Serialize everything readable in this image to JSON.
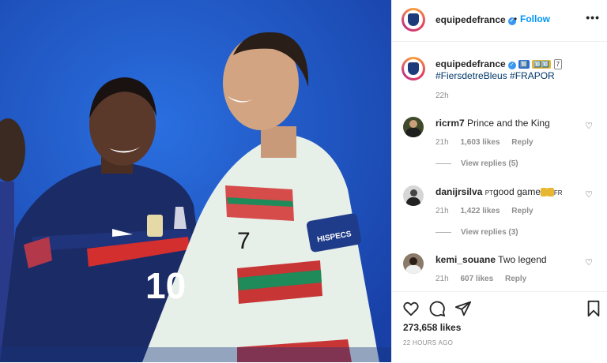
{
  "header": {
    "username": "equipedefrance",
    "verified_glyph": "✓",
    "follow_label": "Follow",
    "more_label": "•••"
  },
  "caption": {
    "username": "equipedefrance",
    "emoji_badges": [
      "🔟",
      "🔟🔟",
      "7"
    ],
    "hashtags": "#FiersdetreBleus #FRAPOR",
    "time": "22h"
  },
  "comments": [
    {
      "username": "ricrm7",
      "text": "Prince and the King",
      "time": "21h",
      "likes": "1,603 likes",
      "reply": "Reply",
      "view_replies": "View replies (5)"
    },
    {
      "username": "danijrsilva",
      "flag_prefix": "PT",
      "text": "good game",
      "flag_suffix": "FR",
      "time": "21h",
      "likes": "1,422 likes",
      "reply": "Reply",
      "view_replies": "View replies (3)"
    },
    {
      "username": "kemi_souane",
      "text": "Two legend",
      "time": "21h",
      "likes": "607 likes",
      "reply": "Reply"
    }
  ],
  "icons": {
    "like": "heart-icon",
    "comment": "comment-icon",
    "share": "share-icon",
    "save": "bookmark-icon",
    "more": "more-icon"
  },
  "post": {
    "likes": "273,658 likes",
    "posted": "22 HOURS AGO"
  },
  "photo": {
    "shirt_number_left": "10",
    "shirt_number_right": "7",
    "armband_text": "HISPECS"
  },
  "colors": {
    "accent": "#0095f6",
    "verified": "#3897f0",
    "background_photo": "#1f5fd6",
    "france_shirt": "#1b2b66",
    "portugal_shirt": "#e7efe9"
  }
}
